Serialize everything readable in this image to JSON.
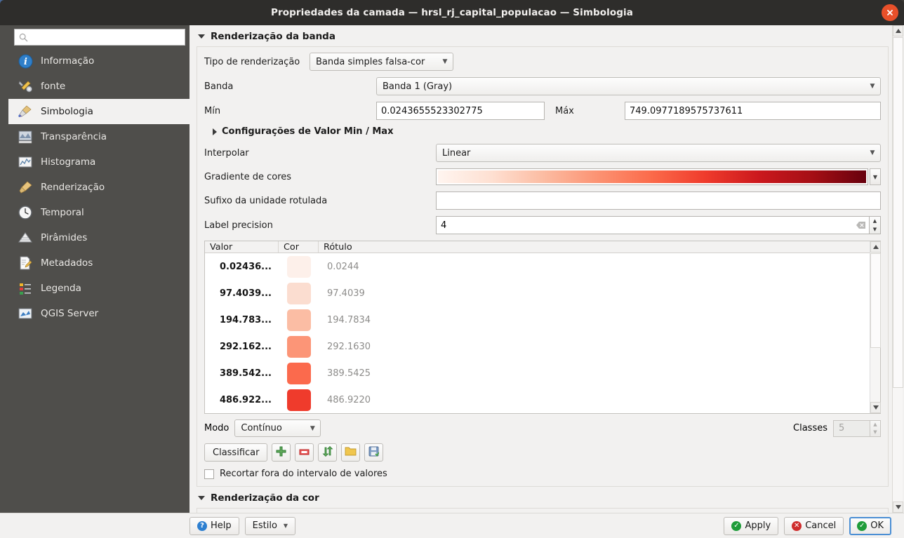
{
  "window": {
    "title": "Propriedades da camada — hrsl_rj_capital_populacao — Simbologia",
    "close_icon": "close-icon"
  },
  "sidebar": {
    "search_placeholder": "",
    "search_value": "",
    "items": [
      {
        "label": "Informação",
        "icon": "info-icon",
        "active": false
      },
      {
        "label": "fonte",
        "icon": "wrench-icon",
        "active": false
      },
      {
        "label": "Simbologia",
        "icon": "paintbrush-icon",
        "active": true
      },
      {
        "label": "Transparência",
        "icon": "transparency-icon",
        "active": false
      },
      {
        "label": "Histograma",
        "icon": "histogram-icon",
        "active": false
      },
      {
        "label": "Renderização",
        "icon": "brush-icon",
        "active": false
      },
      {
        "label": "Temporal",
        "icon": "clock-icon",
        "active": false
      },
      {
        "label": "Pirâmides",
        "icon": "pyramid-icon",
        "active": false
      },
      {
        "label": "Metadados",
        "icon": "document-edit-icon",
        "active": false
      },
      {
        "label": "Legenda",
        "icon": "legend-icon",
        "active": false
      },
      {
        "label": "QGIS Server",
        "icon": "server-icon",
        "active": false
      }
    ]
  },
  "band_rendering": {
    "group_title": "Renderização da banda",
    "render_type_label": "Tipo de renderização",
    "render_type_value": "Banda simples falsa-cor",
    "band_label": "Banda",
    "band_value": "Banda 1 (Gray)",
    "min_label": "Mín",
    "min_value": "0.0243655523302775",
    "max_label": "Máx",
    "max_value": "749.0977189575737611",
    "minmax_settings_label": "Configurações de Valor Min / Max",
    "interpolate_label": "Interpolar",
    "interpolate_value": "Linear",
    "gradient_label": "Gradiente de cores",
    "gradient_stops": [
      "#fff5f0",
      "#fee0d2",
      "#fcbba1",
      "#fc9272",
      "#fb6a4a",
      "#ef3b2c",
      "#cb181d",
      "#a50f15",
      "#67000d"
    ],
    "unit_suffix_label": "Sufixo da unidade rotulada",
    "unit_suffix_value": "",
    "label_precision_label": "Label precision",
    "label_precision_value": "4"
  },
  "color_table": {
    "headers": [
      "Valor",
      "Cor",
      "Rótulo"
    ],
    "rows": [
      {
        "valor": "0.02436...",
        "cor": "#fdf0ea",
        "rotulo": "0.0244"
      },
      {
        "valor": "97.4039...",
        "cor": "#fbddd0",
        "rotulo": "97.4039"
      },
      {
        "valor": "194.783...",
        "cor": "#fbbda4",
        "rotulo": "194.7834"
      },
      {
        "valor": "292.162...",
        "cor": "#fc9577",
        "rotulo": "292.1630"
      },
      {
        "valor": "389.542...",
        "cor": "#fb6a4d",
        "rotulo": "389.5425"
      },
      {
        "valor": "486.922...",
        "cor": "#ef3b2c",
        "rotulo": "486.9220"
      }
    ]
  },
  "controls": {
    "mode_label": "Modo",
    "mode_value": "Contínuo",
    "classes_label": "Classes",
    "classes_value": "5",
    "classify_label": "Classificar",
    "icon_buttons": [
      {
        "name": "add-entry-icon",
        "title": "add"
      },
      {
        "name": "remove-entry-icon",
        "title": "remove"
      },
      {
        "name": "sort-entries-icon",
        "title": "sort"
      },
      {
        "name": "load-color-map-icon",
        "title": "load"
      },
      {
        "name": "save-color-map-icon",
        "title": "save"
      }
    ],
    "clip_checkbox_label": "Recortar fora do intervalo de valores",
    "clip_checked": false
  },
  "color_rendering": {
    "group_title": "Renderização da cor"
  },
  "footer": {
    "help_label": "Help",
    "style_label": "Estilo",
    "apply_label": "Apply",
    "cancel_label": "Cancel",
    "ok_label": "OK"
  },
  "colors": {
    "accent_blue": "#4b8fd4",
    "close_red": "#e8502a",
    "ok_green": "#1f9c3a",
    "cancel_red": "#cf2d2d",
    "sidebar_bg": "#4f4e4b",
    "titlebar_bg": "#2e2d2b"
  }
}
